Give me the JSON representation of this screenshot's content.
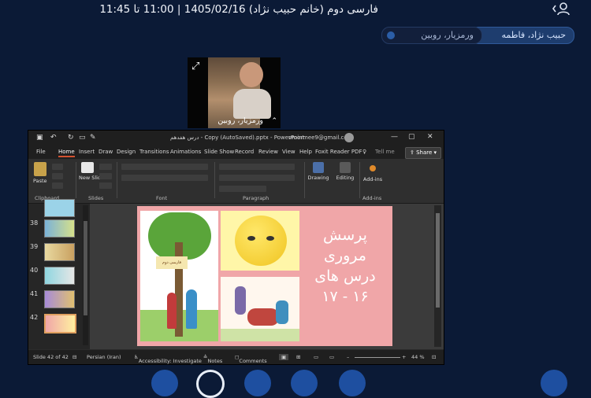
{
  "header": {
    "title": "فارسی دوم (خانم حبیب نژاد) 1405/02/16 | 11:00 تا 11:45",
    "user_icon": "user-icon"
  },
  "participants": [
    {
      "name": "حبیب نژاد، فاطمه",
      "active": true
    },
    {
      "name": "ورمزیار، روبین",
      "active": false
    }
  ],
  "camera": {
    "name": "ورمزیار، روبین",
    "expand_icon": "expand-icon",
    "caret": "⌃"
  },
  "ppt": {
    "doc_title": "درس هفدهم - Copy (AutoSaved).pptx - PowerPoint",
    "account": "vmormee9@gmail.com",
    "tabs": [
      "File",
      "Home",
      "Insert",
      "Draw",
      "Design",
      "Transitions",
      "Animations",
      "Slide Show",
      "Record",
      "Review",
      "View",
      "Help",
      "Foxit Reader PDF",
      "Tell me"
    ],
    "share_label": "Share",
    "ribbon": {
      "paste": "Paste",
      "new_slide": "New Slide",
      "drawing": "Drawing",
      "editing": "Editing",
      "addins": "Add-ins",
      "groups": [
        "Clipboard",
        "Slides",
        "Font",
        "Paragraph",
        "Add-ins"
      ]
    },
    "thumbnails": [
      "38",
      "39",
      "40",
      "41",
      "42"
    ],
    "slide": {
      "text_lines": [
        "پرسش",
        "مروری",
        "درس های",
        "۱۶ - ۱۷"
      ],
      "book_label": "فارسی دوم"
    },
    "status": {
      "slide_count": "Slide 42 of 42",
      "language": "Persian (Iran)",
      "accessibility": "Accessibility: Investigate",
      "notes": "Notes",
      "comments": "Comments",
      "zoom": "44 %"
    }
  },
  "colors": {
    "background": "#0b1a36",
    "chip_active": "#1e3d6e",
    "slide_pink": "#f0a6a8",
    "accent": "#d35230"
  }
}
